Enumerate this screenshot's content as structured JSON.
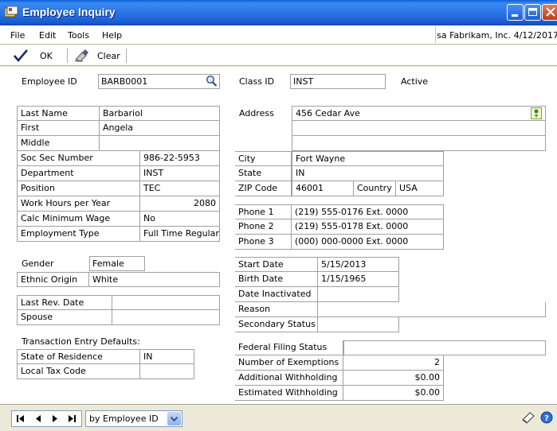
{
  "window": {
    "title": "Employee Inquiry"
  },
  "menu": {
    "file": "File",
    "edit": "Edit",
    "tools": "Tools",
    "help": "Help",
    "status": "sa  Fabrikam, Inc.  4/12/2017"
  },
  "toolbar": {
    "ok": "OK",
    "clear": "Clear"
  },
  "left": {
    "employee_id_label": "Employee ID",
    "employee_id": "BARB0001",
    "last_name_label": "Last Name",
    "last_name": "Barbariol",
    "first_label": "First",
    "first": "Angela",
    "middle_label": "Middle",
    "middle": "",
    "ssn_label": "Soc Sec Number",
    "ssn": "986-22-5953",
    "department_label": "Department",
    "department": "INST",
    "position_label": "Position",
    "position": "TEC",
    "work_hours_label": "Work Hours per Year",
    "work_hours": "2080",
    "calc_min_wage_label": "Calc Minimum Wage",
    "calc_min_wage": "No",
    "employment_type_label": "Employment Type",
    "employment_type": "Full Time Regular",
    "gender_label": "Gender",
    "gender": "Female",
    "ethnic_origin_label": "Ethnic Origin",
    "ethnic_origin": "White",
    "last_rev_date_label": "Last Rev. Date",
    "last_rev_date": "",
    "spouse_label": "Spouse",
    "spouse": "",
    "tax_defaults_label": "Transaction Entry Defaults:",
    "state_residence_label": "State of Residence",
    "state_residence": "IN",
    "local_tax_label": "Local Tax Code",
    "local_tax": ""
  },
  "right": {
    "class_id_label": "Class ID",
    "class_id": "INST",
    "active": "Active",
    "address_label": "Address",
    "address1": "456 Cedar Ave",
    "address2": "",
    "address3": "",
    "city_label": "City",
    "city": "Fort Wayne",
    "state_label": "State",
    "state": "IN",
    "zip_label": "ZIP Code",
    "zip": "46001",
    "country_label": "Country",
    "country": "USA",
    "phone1_label": "Phone 1",
    "phone1": "(219) 555-0176  Ext. 0000",
    "phone2_label": "Phone 2",
    "phone2": "(219) 555-0178  Ext. 0000",
    "phone3_label": "Phone 3",
    "phone3": "(000) 000-0000  Ext. 0000",
    "start_date_label": "Start Date",
    "start_date": "5/15/2013",
    "birth_date_label": "Birth Date",
    "birth_date": "1/15/1965",
    "date_inactivated_label": "Date Inactivated",
    "date_inactivated": "",
    "reason_label": "Reason",
    "reason": "",
    "secondary_status_label": "Secondary Status",
    "secondary_status": "",
    "federal_filing_label": "Federal Filing Status",
    "federal_filing": "",
    "exemptions_label": "Number of Exemptions",
    "exemptions": "2",
    "additional_withholding_label": "Additional Withholding",
    "additional_withholding": "$0.00",
    "estimated_withholding_label": "Estimated Withholding",
    "estimated_withholding": "$0.00"
  },
  "bottom": {
    "sort_by": "by Employee ID"
  },
  "icons": {
    "ok": "checkmark-icon",
    "clear": "eraser-icon",
    "lookup": "magnifier-icon",
    "address_lookup": "address-pin-icon",
    "note": "note-icon",
    "help": "help-icon"
  }
}
